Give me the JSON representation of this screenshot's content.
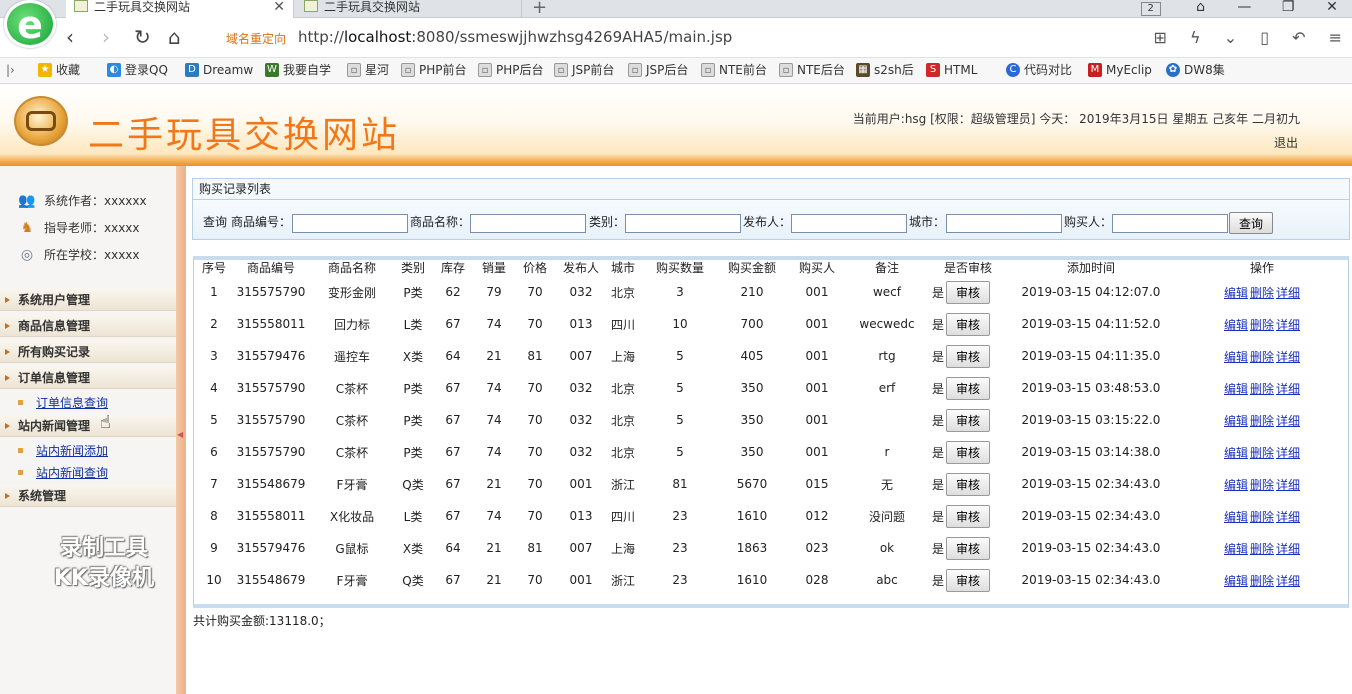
{
  "browser": {
    "tabs": [
      {
        "title": "二手玩具交换网站",
        "active": true
      },
      {
        "title": "二手玩具交换网站",
        "active": false
      }
    ],
    "tab_count": "2",
    "redirect_label": "域名重定向",
    "url_prefix": "http://",
    "url_host": "localhost",
    "url_rest": ":8080/ssmeswjjhwzhsg4269AHA5/main.jsp",
    "bookmarks": [
      "收藏",
      "登录QQ",
      "Dreamw",
      "我要自学",
      "星河",
      "PHP前台",
      "PHP后台",
      "JSP前台",
      "JSP后台",
      "NTE前台",
      "NTE后台",
      "s2sh后",
      "HTML",
      "代码对比",
      "MyEclip",
      "DW8集"
    ]
  },
  "header": {
    "site_title": "二手玩具交换网站",
    "user_info": "当前用户:hsg [权限：超级管理员] 今天： 2019年3月15日 星期五 己亥年 二月初九",
    "logout": "退出"
  },
  "sidebar": {
    "info": [
      {
        "label": "系统作者：xxxxxx",
        "icon": "users-icon"
      },
      {
        "label": "指导老师：xxxxx",
        "icon": "teacher-icon"
      },
      {
        "label": "所在学校：xxxxx",
        "icon": "school-icon"
      }
    ],
    "menus": [
      "系统用户管理",
      "商品信息管理",
      "所有购买记录",
      "订单信息管理",
      "站内新闻管理",
      "系统管理"
    ],
    "submenus": {
      "order": [
        "订单信息查询"
      ],
      "news": [
        "站内新闻添加",
        "站内新闻查询"
      ]
    },
    "watermark_line1": "录制工具",
    "watermark_line2": "KK录像机"
  },
  "panel": {
    "title": "购买记录列表",
    "search": {
      "prefix": "查询",
      "fields": [
        "商品编号：",
        "商品名称：",
        "类别：",
        "发布人：",
        "城市：",
        "购买人："
      ],
      "button": "查询"
    }
  },
  "table": {
    "columns": [
      "序号",
      "商品编号",
      "商品名称",
      "类别",
      "库存",
      "销量",
      "价格",
      "发布人",
      "城市",
      "购买数量",
      "购买金额",
      "购买人",
      "备注",
      "是否审核",
      "添加时间",
      "操作"
    ],
    "audit_button": "审核",
    "ops": [
      "编辑",
      "删除",
      "详细"
    ],
    "rows": [
      [
        "1",
        "315575790",
        "变形金刚",
        "P类",
        "62",
        "79",
        "70",
        "032",
        "北京",
        "3",
        "210",
        "001",
        "wecf",
        "是",
        "2019-03-15 04:12:07.0"
      ],
      [
        "2",
        "315558011",
        "回力标",
        "L类",
        "67",
        "74",
        "70",
        "013",
        "四川",
        "10",
        "700",
        "001",
        "wecwedc",
        "是",
        "2019-03-15 04:11:52.0"
      ],
      [
        "3",
        "315579476",
        "遥控车",
        "X类",
        "64",
        "21",
        "81",
        "007",
        "上海",
        "5",
        "405",
        "001",
        "rtg",
        "是",
        "2019-03-15 04:11:35.0"
      ],
      [
        "4",
        "315575790",
        "C茶杯",
        "P类",
        "67",
        "74",
        "70",
        "032",
        "北京",
        "5",
        "350",
        "001",
        "erf",
        "是",
        "2019-03-15 03:48:53.0"
      ],
      [
        "5",
        "315575790",
        "C茶杯",
        "P类",
        "67",
        "74",
        "70",
        "032",
        "北京",
        "5",
        "350",
        "001",
        "",
        "是",
        "2019-03-15 03:15:22.0"
      ],
      [
        "6",
        "315575790",
        "C茶杯",
        "P类",
        "67",
        "74",
        "70",
        "032",
        "北京",
        "5",
        "350",
        "001",
        "r",
        "是",
        "2019-03-15 03:14:38.0"
      ],
      [
        "7",
        "315548679",
        "F牙膏",
        "Q类",
        "67",
        "21",
        "70",
        "001",
        "浙江",
        "81",
        "5670",
        "015",
        "无",
        "是",
        "2019-03-15 02:34:43.0"
      ],
      [
        "8",
        "315558011",
        "X化妆品",
        "L类",
        "67",
        "74",
        "70",
        "013",
        "四川",
        "23",
        "1610",
        "012",
        "没问题",
        "是",
        "2019-03-15 02:34:43.0"
      ],
      [
        "9",
        "315579476",
        "G鼠标",
        "X类",
        "64",
        "21",
        "81",
        "007",
        "上海",
        "23",
        "1863",
        "023",
        "ok",
        "是",
        "2019-03-15 02:34:43.0"
      ],
      [
        "10",
        "315548679",
        "F牙膏",
        "Q类",
        "67",
        "21",
        "70",
        "001",
        "浙江",
        "23",
        "1610",
        "028",
        "abc",
        "是",
        "2019-03-15 02:34:43.0"
      ]
    ]
  },
  "total": "共计购买金额:13118.0；",
  "colors": {
    "accent": "#f07818",
    "link": "#1a2fbf",
    "border": "#b5d0e8"
  }
}
